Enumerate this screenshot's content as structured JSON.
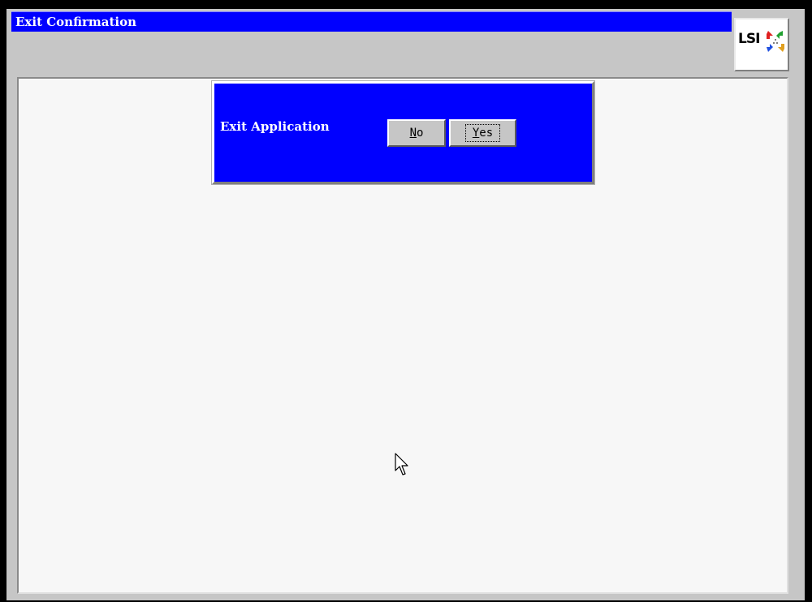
{
  "window": {
    "title": "Exit Confirmation"
  },
  "logo": {
    "text": "LSI",
    "name": "lsi-logo"
  },
  "dialog": {
    "label": "Exit Application",
    "buttons": {
      "no": {
        "mnemonic": "N",
        "rest": "o"
      },
      "yes": {
        "mnemonic": "Y",
        "rest": "es",
        "focused": true
      }
    }
  },
  "colors": {
    "title_bar": "#0000ff",
    "dialog_bg": "#0000ff",
    "window_bg": "#c6c6c6",
    "content_bg": "#f7f7f7",
    "button_bg": "#c6c6c6"
  },
  "icons": {
    "logo_mark": "lsi-arrows-icon",
    "cursor": "mouse-pointer-icon"
  }
}
